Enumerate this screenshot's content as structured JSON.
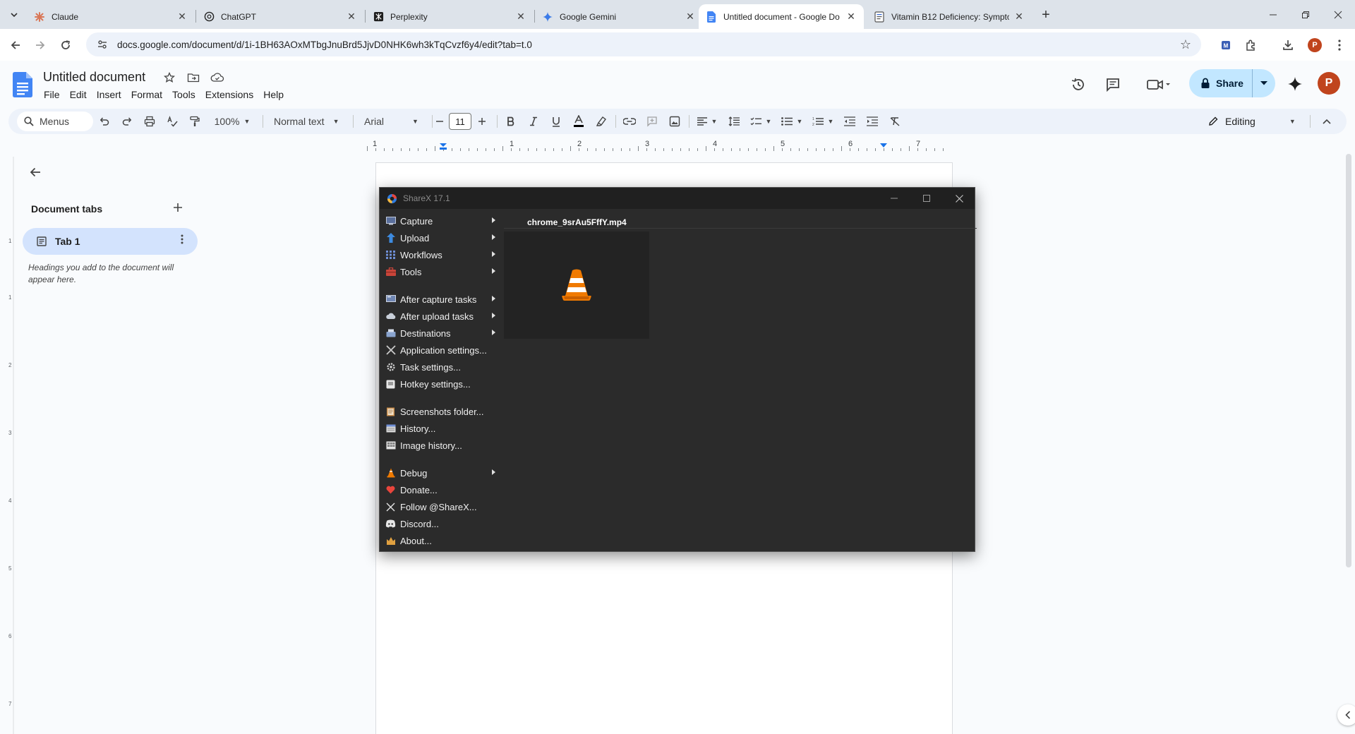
{
  "browser": {
    "tabs": [
      {
        "title": "Claude",
        "icon": "claude-icon"
      },
      {
        "title": "ChatGPT",
        "icon": "chatgpt-icon"
      },
      {
        "title": "Perplexity",
        "icon": "perplexity-icon"
      },
      {
        "title": "Google Gemini",
        "icon": "gemini-icon"
      },
      {
        "title": "Untitled document - Google Do",
        "icon": "docs-icon",
        "active": true
      },
      {
        "title": "Vitamin B12 Deficiency: Sympto",
        "icon": "page-icon"
      }
    ],
    "url": "docs.google.com/document/d/1i-1BH63AOxMTbgJnuBrd5JjvD0NHK6wh3kTqCvzf6y4/edit?tab=t.0",
    "profile_initial": "P"
  },
  "docs": {
    "title": "Untitled document",
    "menu": [
      "File",
      "Edit",
      "Insert",
      "Format",
      "Tools",
      "Extensions",
      "Help"
    ],
    "share_label": "Share",
    "avatar_initial": "P",
    "toolbar": {
      "search_label": "Menus",
      "zoom": "100%",
      "style": "Normal text",
      "font": "Arial",
      "font_size": "11",
      "mode": "Editing"
    },
    "ruler_numbers": [
      "1",
      "1",
      "2",
      "3",
      "4",
      "5",
      "6",
      "7"
    ],
    "sidebar": {
      "title": "Document tabs",
      "tab_label": "Tab 1",
      "hint": "Headings you add to the document will appear here."
    }
  },
  "sharex": {
    "title": "ShareX 17.1",
    "menu": [
      {
        "label": "Capture",
        "submenu": true,
        "icon": "capture-icon"
      },
      {
        "label": "Upload",
        "submenu": true,
        "icon": "upload-icon"
      },
      {
        "label": "Workflows",
        "submenu": true,
        "icon": "workflows-icon"
      },
      {
        "label": "Tools",
        "submenu": true,
        "icon": "tools-icon"
      },
      {
        "label": "After capture tasks",
        "submenu": true,
        "icon": "after-capture-icon",
        "gap_before": true
      },
      {
        "label": "After upload tasks",
        "submenu": true,
        "icon": "after-upload-icon"
      },
      {
        "label": "Destinations",
        "submenu": true,
        "icon": "destinations-icon"
      },
      {
        "label": "Application settings...",
        "submenu": false,
        "icon": "app-settings-icon"
      },
      {
        "label": "Task settings...",
        "submenu": false,
        "icon": "task-settings-icon"
      },
      {
        "label": "Hotkey settings...",
        "submenu": false,
        "icon": "hotkey-settings-icon"
      },
      {
        "label": "Screenshots folder...",
        "submenu": false,
        "icon": "folder-icon",
        "gap_before": true
      },
      {
        "label": "History...",
        "submenu": false,
        "icon": "history-icon"
      },
      {
        "label": "Image history...",
        "submenu": false,
        "icon": "image-history-icon"
      },
      {
        "label": "Debug",
        "submenu": true,
        "icon": "debug-icon",
        "gap_before": true
      },
      {
        "label": "Donate...",
        "submenu": false,
        "icon": "heart-icon"
      },
      {
        "label": "Follow @ShareX...",
        "submenu": false,
        "icon": "x-logo-icon"
      },
      {
        "label": "Discord...",
        "submenu": false,
        "icon": "discord-icon"
      },
      {
        "label": "About...",
        "submenu": false,
        "icon": "about-icon"
      }
    ],
    "file": "chrome_9srAu5FffY.mp4"
  },
  "colors": {
    "docs_blue": "#4285f4",
    "share_bg": "#c2e7ff",
    "tab_highlight": "#d3e3fd",
    "sharex_bg": "#2b2b2b",
    "vlc_orange": "#f07a00"
  }
}
